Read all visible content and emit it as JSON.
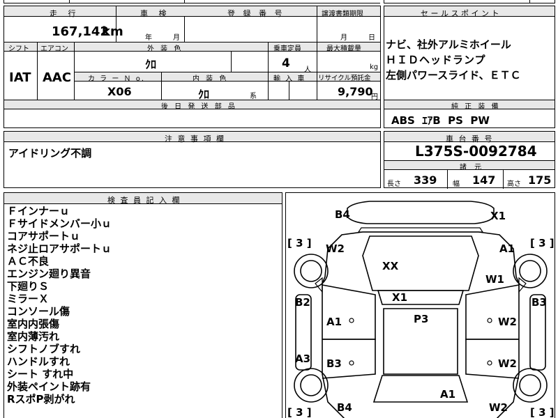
{
  "header": {
    "distance_label": "走 行",
    "distance_value": "167,142",
    "distance_unit": "km",
    "inspection_label": "車 検",
    "inspection_year_unit": "年",
    "inspection_month_unit": "月",
    "registration_label": "登 録 番 号",
    "transfer_label": "譲渡書類期限",
    "transfer_month_unit": "月",
    "transfer_day_unit": "日"
  },
  "specs": {
    "shift_label": "シフト",
    "shift_value": "IAT",
    "aircon_label": "エアコン",
    "aircon_value": "AAC",
    "exterior_color_label": "外 装 色",
    "exterior_color_value": "ｸﾛ",
    "capacity_label": "乗車定員",
    "capacity_value": "4",
    "capacity_unit": "人",
    "max_load_label": "最大積載量",
    "max_load_unit": "kg",
    "color_no_label": "カ ラ ー Ｎ ο.",
    "color_no_value": "X06",
    "interior_color_label": "内 装 色",
    "interior_color_value": "ｸﾛ",
    "interior_color_suffix": "系",
    "import_label": "輸 入 車",
    "recycle_label": "リサイクル預託金",
    "recycle_value": "9,790",
    "recycle_unit": "円",
    "later_parts_label": "後 日 発 送 部 品"
  },
  "sales_points": {
    "label": "セ ー ル ス ポ イ ン ト",
    "lines": [
      "ナビ、社外アルミホイール",
      "ＨＩＤヘッドランプ",
      "左側パワースライド、ＥＴＣ"
    ]
  },
  "genuine_equipment": {
    "label": "純 正 装 備",
    "value": "ABS  ｴｱB  PS  PW"
  },
  "caution": {
    "label": "注 意 事 項 欄",
    "value": "アイドリング不調"
  },
  "chassis": {
    "label": "車 台 番 号",
    "value": "L375S-0092784",
    "dimensions_label": "諸 元",
    "length_label": "長さ",
    "length_value": "339",
    "width_label": "幅",
    "width_value": "147",
    "height_label": "高さ",
    "height_value": "175"
  },
  "inspector": {
    "label": "検 査 員 記 入 欄",
    "lines": [
      "Ｆインナーｕ",
      "Ｆサイドメンバー小ｕ",
      "コアサポートｕ",
      "ネジ止ロアサポートｕ",
      "ＡＣ不良",
      "エンジン廻り異音",
      "下廻りＳ",
      "ミラーＸ",
      "コンソール傷",
      "室内内張傷",
      "室内薄汚れ",
      "シフトノブすれ",
      "ハンドルすれ",
      "シート すれ中",
      "外装ペイント跡有",
      "RスポP剥がれ"
    ]
  },
  "diagram": {
    "codes": {
      "b4_top": "B4",
      "x1_top": "X1",
      "w2_left": "W2",
      "a1_right": "A1",
      "xx": "XX",
      "w1": "W1",
      "x1_mid": "X1",
      "b2": "B2",
      "b3_right": "B3",
      "a1_left": "A1",
      "p3": "P3",
      "w2_right_a": "W2",
      "a3": "A3",
      "b3_left": "B3",
      "w2_right_b": "W2",
      "a1_bottom": "A1",
      "b4_bottom": "B4",
      "w2_bottom": "W2"
    },
    "tire_marks": {
      "front_left": "[ 3 ]",
      "front_right": "[ 3 ]",
      "rear_left": "[ 3 ]",
      "rear_right": "[ 3 ]"
    }
  }
}
